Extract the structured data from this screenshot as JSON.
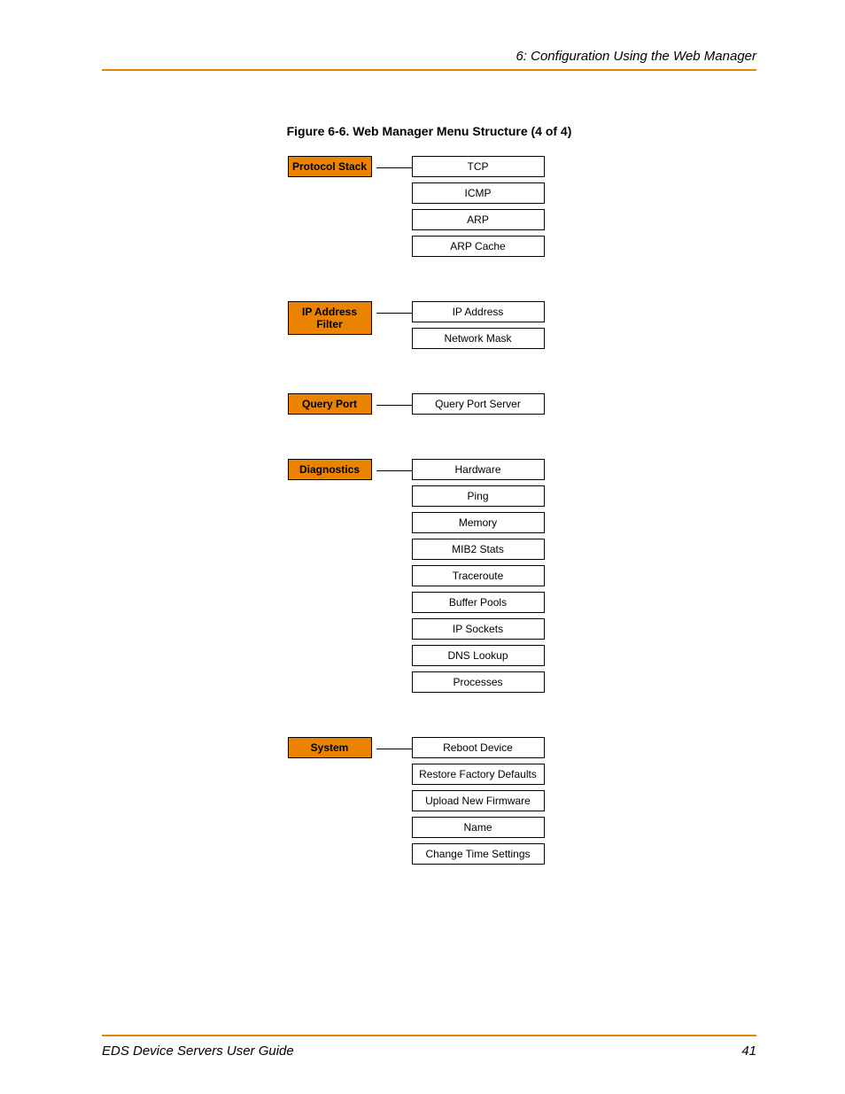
{
  "header": "6: Configuration Using the Web Manager",
  "caption": "Figure 6-6. Web Manager Menu Structure (4 of 4)",
  "groups": [
    {
      "parent": "Protocol Stack",
      "children": [
        "TCP",
        "ICMP",
        "ARP",
        "ARP Cache"
      ]
    },
    {
      "parent": "IP Address Filter",
      "children": [
        "IP Address",
        "Network Mask"
      ]
    },
    {
      "parent": "Query Port",
      "children": [
        "Query Port Server"
      ]
    },
    {
      "parent": "Diagnostics",
      "children": [
        "Hardware",
        "Ping",
        "Memory",
        "MIB2 Stats",
        "Traceroute",
        "Buffer Pools",
        "IP Sockets",
        "DNS Lookup",
        "Processes"
      ]
    },
    {
      "parent": "System",
      "children": [
        "Reboot Device",
        "Restore Factory Defaults",
        "Upload New Firmware",
        "Name",
        "Change Time Settings"
      ]
    }
  ],
  "footer": {
    "left": "EDS Device Servers User Guide",
    "right": "41"
  }
}
